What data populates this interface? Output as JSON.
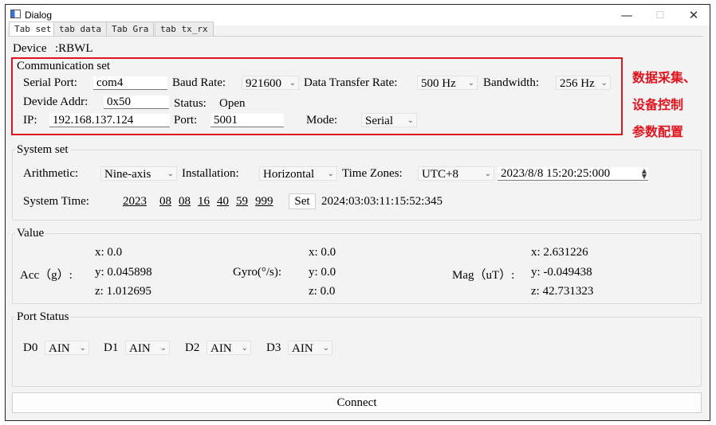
{
  "window": {
    "title": "Dialog",
    "minimize_icon": "minimize-icon",
    "maximize_icon": "maximize-icon",
    "close_icon": "close-icon"
  },
  "window_controls": {
    "minimize": "—",
    "maximize": "☐",
    "close": "✕"
  },
  "tabs": [
    "Tab set",
    "tab data",
    "Tab Gra",
    "tab tx_rx"
  ],
  "device": {
    "label": "Device",
    "value": ":RBWL"
  },
  "communication": {
    "title": "Communication set",
    "serial_port_label": "Serial Port:",
    "serial_port_value": "com4",
    "baud_rate_label": "Baud Rate:",
    "baud_rate_value": "921600",
    "data_rate_label": "Data Transfer Rate:",
    "data_rate_value": "500 Hz",
    "bandwidth_label": "Bandwidth:",
    "bandwidth_value": "256 Hz",
    "device_addr_label": "Devide Addr:",
    "device_addr_value": "0x50",
    "status_label": "Status:",
    "status_value": "Open",
    "ip_label": "IP:",
    "ip_value": "192.168.137.124",
    "port_label": "Port:",
    "port_value": "5001",
    "mode_label": "Mode:",
    "mode_value": "Serial"
  },
  "annotation": {
    "line1": "数据采集、",
    "line2": "设备控制",
    "line3": "参数配置",
    "color": "#e0141e"
  },
  "system": {
    "title": "System set",
    "arithmetic_label": "Arithmetic:",
    "arithmetic_value": "Nine-axis",
    "installation_label": "Installation:",
    "installation_value": "Horizontal",
    "timezones_label": "Time Zones:",
    "timezone_value": "UTC+8",
    "datetime_value": "2023/8/8 15:20:25:000",
    "system_time_label": "System Time:",
    "time_parts": [
      "2023",
      "08",
      "08",
      "16",
      "40",
      "59",
      "999"
    ],
    "set_button": "Set",
    "current_time": "2024:03:03:11:15:52:345"
  },
  "value": {
    "title": "Value",
    "acc_label": "Acc（g）:",
    "acc_x": "x: 0.0",
    "acc_y": "y: 0.045898",
    "acc_z": "z: 1.012695",
    "gyro_label": "Gyro(°/s):",
    "gyro_x": "x: 0.0",
    "gyro_y": "y: 0.0",
    "gyro_z": "z: 0.0",
    "mag_label": "Mag（uT）:",
    "mag_x": "x: 2.631226",
    "mag_y": "y: -0.049438",
    "mag_z": "z: 42.731323"
  },
  "port_status": {
    "title": "Port Status",
    "ports": [
      {
        "label": "D0",
        "value": "AIN"
      },
      {
        "label": "D1",
        "value": "AIN"
      },
      {
        "label": "D2",
        "value": "AIN"
      },
      {
        "label": "D3",
        "value": "AIN"
      }
    ]
  },
  "connect_button": "Connect"
}
